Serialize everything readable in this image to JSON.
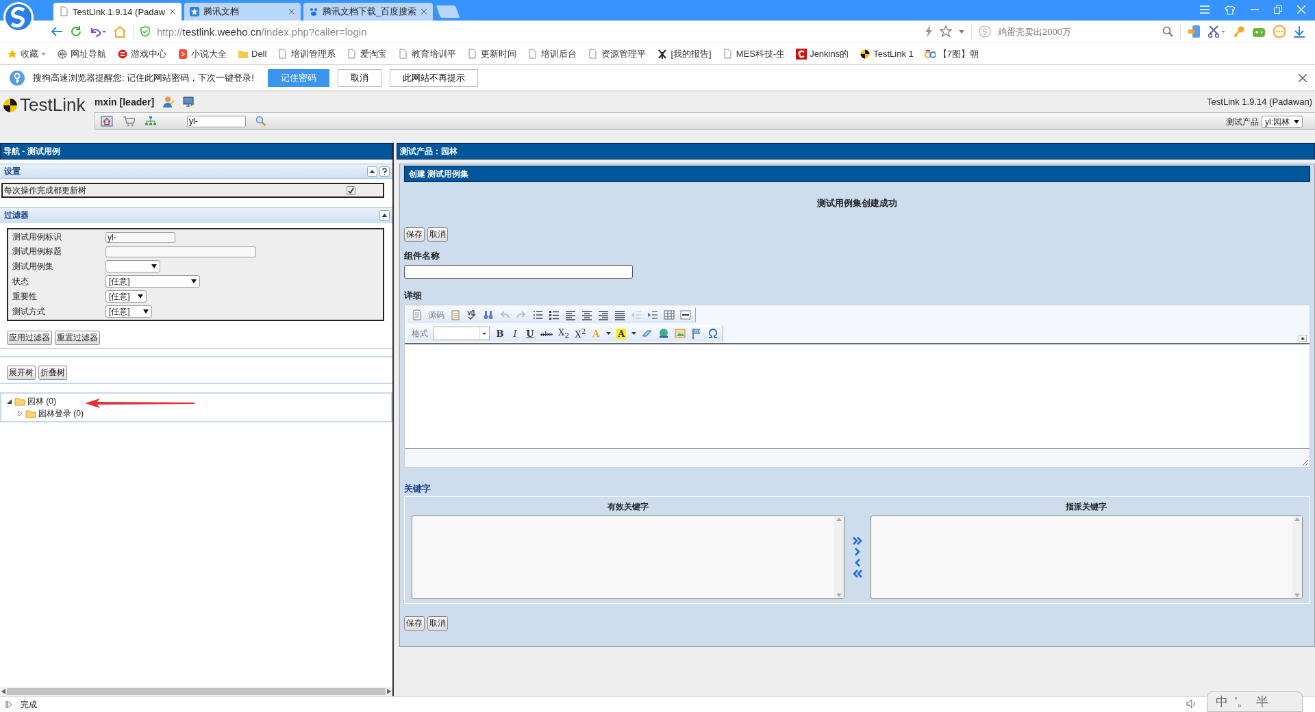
{
  "browser": {
    "tabs": [
      {
        "title": "TestLink 1.9.14 (Padaw",
        "selected": true
      },
      {
        "title": "腾讯文档",
        "selected": false
      },
      {
        "title": "腾讯文档下载_百度搜索",
        "selected": false
      }
    ],
    "url": "http://**testlink.weeho.cn**/index.php?caller=login",
    "search": {
      "placeholder": "鸡蛋壳卖出2000万"
    },
    "bookmarks": [
      "收藏",
      "网址导航",
      "游戏中心",
      "小说大全",
      "Dell",
      "培训管理系",
      "爱淘宝",
      "教育培训平",
      "更新时间",
      "培训后台",
      "资源管理平",
      "[我的报告]",
      "MES科技-生",
      "Jenkins的",
      "TestLink 1",
      "【7图】朝"
    ],
    "notification": {
      "text": "搜狗高速浏览器提醒您:  记住此网站密码，下次一键登录!",
      "buttons": [
        {
          "label": "记住密码",
          "selected": true
        },
        {
          "label": "取消",
          "selected": false
        },
        {
          "label": "此网站不再提示",
          "selected": false
        }
      ]
    }
  },
  "header": {
    "logo": "TestLink",
    "user": "mxin [leader]",
    "search": {
      "value": "yl-"
    },
    "version": "TestLink 1.9.14 (Padawan)",
    "product_label": "测试产品",
    "product": "yl:园林"
  },
  "nav": {
    "title": "导航 - 测试用例",
    "settings": {
      "title": "设置",
      "option": {
        "label": "每次操作完成都更新树",
        "checked": true
      }
    },
    "filters": {
      "title": "过滤器",
      "fields": [
        {
          "label": "测试用例标识",
          "kind": "text",
          "value": "yl-"
        },
        {
          "label": "测试用例标题",
          "kind": "text"
        },
        {
          "label": "测试用例集",
          "kind": "select"
        },
        {
          "label": "状态",
          "kind": "select",
          "value": "[任意]"
        },
        {
          "label": "重要性",
          "kind": "select",
          "value": "[任意]"
        },
        {
          "label": "测试方式",
          "kind": "select",
          "value": "[任意]"
        }
      ],
      "buttons": [
        "应用过滤器",
        "重置过滤器"
      ]
    },
    "tree_buttons": [
      "展开树",
      "折叠树"
    ],
    "tree": [
      {
        "label": "园林 (0)",
        "expanded": true,
        "children": [
          {
            "label": "园林登录 (0)",
            "expanded": false
          }
        ]
      }
    ]
  },
  "main": {
    "title": "测试产品：园林",
    "form_title": "创建 测试用例集",
    "message": "测试用例集创建成功",
    "buttons": [
      "保存",
      "取消"
    ],
    "name_label": "组件名称",
    "detail_label": "详细",
    "editor": {
      "source_label": "源码",
      "format_label": "格式",
      "format_buttons": [
        {
          "glyph": "B",
          "kind": "bold"
        },
        {
          "glyph": "I",
          "kind": "italic"
        },
        {
          "glyph": "U",
          "kind": "underline"
        },
        {
          "glyph": "abc",
          "kind": "strike"
        },
        {
          "glyph": "X$_{2}$",
          "kind": "sub"
        },
        {
          "glyph": "X$^{2}$",
          "kind": "sup"
        },
        {
          "glyph": "A",
          "kind": "textcolor"
        },
        {
          "glyph": "A",
          "kind": "bgcolor"
        }
      ]
    },
    "keywords": {
      "title": "关键字",
      "available": "有效关键字",
      "assigned": "指派关键字"
    },
    "bottom_buttons": [
      "保存",
      "取消"
    ]
  },
  "status_bar": {
    "text": "完成",
    "ime": [
      "中",
      "'。",
      "半"
    ]
  }
}
